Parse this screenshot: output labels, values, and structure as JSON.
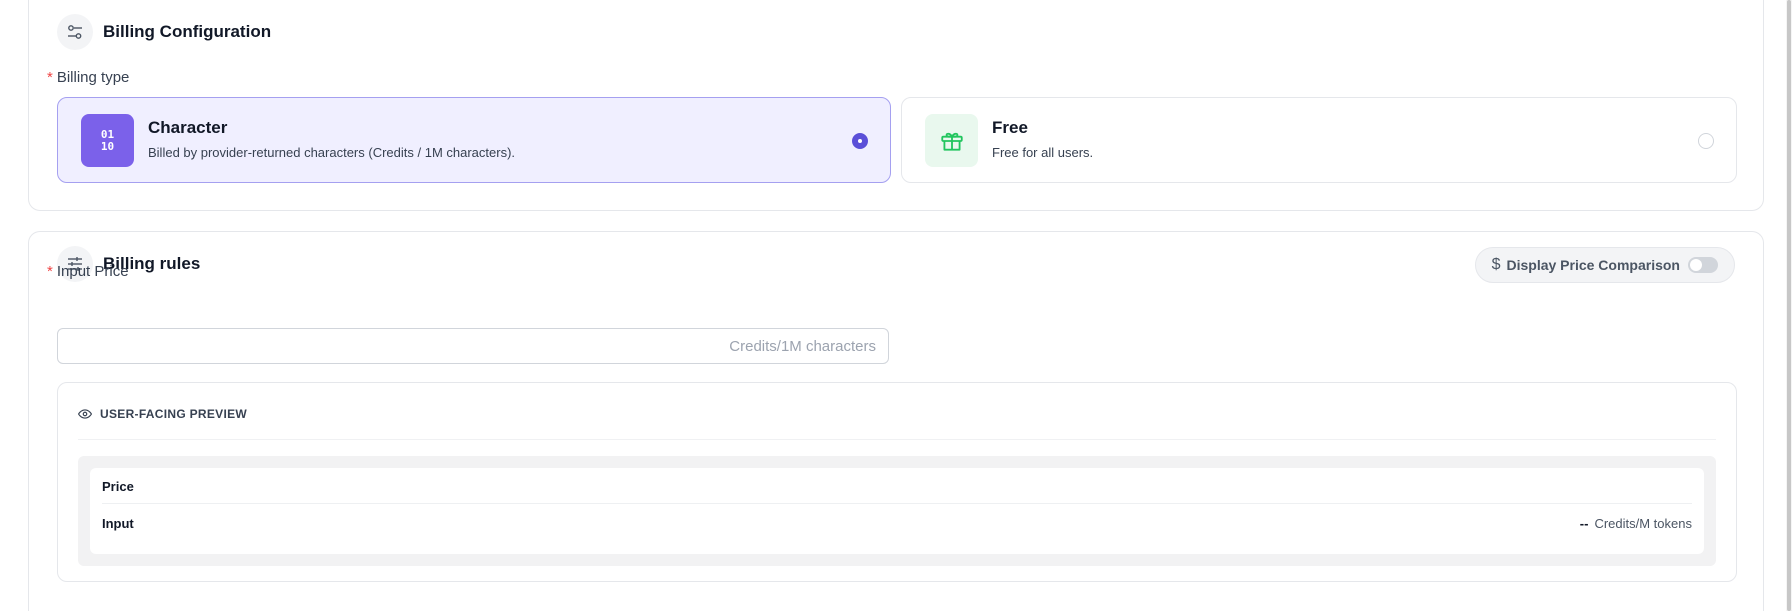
{
  "config": {
    "title": "Billing Configuration",
    "billing_type_label": "Billing type",
    "required_mark": "*",
    "options": [
      {
        "title": "Character",
        "description": "Billed by provider-returned characters (Credits / 1M characters).",
        "icon_text_top": "01",
        "icon_text_bottom": "10",
        "selected": true
      },
      {
        "title": "Free",
        "description": "Free for all users.",
        "selected": false
      }
    ]
  },
  "rules": {
    "title": "Billing rules",
    "price_comparison_label": "Display Price Comparison",
    "price_comparison_enabled": false,
    "input_price_label": "Input Price",
    "input_price_value": "",
    "input_price_placeholder": "Credits/1M characters",
    "preview": {
      "title": "USER-FACING PREVIEW",
      "header_label": "Price",
      "row_label": "Input",
      "row_value": "--",
      "row_unit": "Credits/M tokens"
    }
  },
  "icons": {
    "config": "sliders-icon",
    "rules": "adjustments-icon",
    "character": "binary-icon",
    "free": "gift-icon",
    "preview": "eye-icon",
    "comparison": "dollar-icon"
  },
  "colors": {
    "accent": "#5b4fd8",
    "character_icon_bg": "#7b61ea",
    "selected_bg": "#f0efff",
    "free_icon_color": "#22c55e",
    "required": "#ef4444"
  }
}
